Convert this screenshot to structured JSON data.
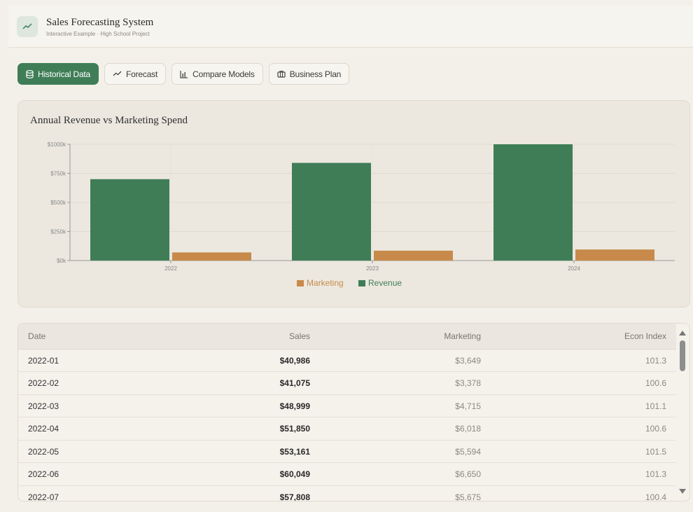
{
  "app": {
    "title": "Sales Forecasting System",
    "subtitle": "Interactive Example · High School Project"
  },
  "tabs": [
    {
      "label": "Historical Data",
      "icon": "database-icon",
      "active": true
    },
    {
      "label": "Forecast",
      "icon": "trend-up-icon",
      "active": false
    },
    {
      "label": "Compare Models",
      "icon": "bar-chart-icon",
      "active": false
    },
    {
      "label": "Business Plan",
      "icon": "briefcase-icon",
      "active": false
    }
  ],
  "colors": {
    "accent": "#3f7d57",
    "revenue": "#3f7d57",
    "marketing": "#c88a4a"
  },
  "chart_data": {
    "type": "bar",
    "title": "Annual Revenue vs Marketing Spend",
    "categories": [
      "2022",
      "2023",
      "2024"
    ],
    "series": [
      {
        "name": "Revenue",
        "values": [
          700000,
          840000,
          1000000
        ]
      },
      {
        "name": "Marketing",
        "values": [
          70000,
          85000,
          95000
        ]
      }
    ],
    "yticks": [
      "$0k",
      "$250k",
      "$500k",
      "$750k",
      "$1000k"
    ],
    "ylim": [
      0,
      1000000
    ],
    "legend": [
      "Marketing",
      "Revenue"
    ],
    "legend_position": "bottom-center",
    "grid": true
  },
  "table": {
    "headers": {
      "date": "Date",
      "sales": "Sales",
      "marketing": "Marketing",
      "econ": "Econ Index"
    },
    "rows": [
      {
        "date": "2022-01",
        "sales": "$40,986",
        "marketing": "$3,649",
        "econ": "101.3"
      },
      {
        "date": "2022-02",
        "sales": "$41,075",
        "marketing": "$3,378",
        "econ": "100.6"
      },
      {
        "date": "2022-03",
        "sales": "$48,999",
        "marketing": "$4,715",
        "econ": "101.1"
      },
      {
        "date": "2022-04",
        "sales": "$51,850",
        "marketing": "$6,018",
        "econ": "100.6"
      },
      {
        "date": "2022-05",
        "sales": "$53,161",
        "marketing": "$5,594",
        "econ": "101.5"
      },
      {
        "date": "2022-06",
        "sales": "$60,049",
        "marketing": "$6,650",
        "econ": "101.3"
      },
      {
        "date": "2022-07",
        "sales": "$57,808",
        "marketing": "$5,675",
        "econ": "100.4"
      }
    ]
  }
}
